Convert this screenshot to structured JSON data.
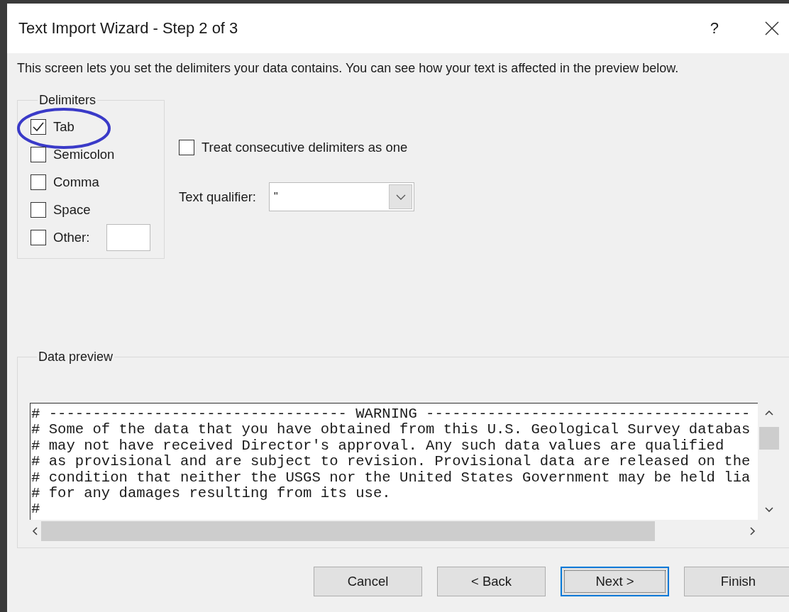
{
  "window": {
    "title": "Text Import Wizard - Step 2 of 3",
    "help": "?"
  },
  "intro": "This screen lets you set the delimiters your data contains.  You can see how your text is affected in the preview below.",
  "delimiters": {
    "legend": "Delimiters",
    "items": [
      {
        "label": "Tab",
        "checked": true,
        "circled": true
      },
      {
        "label": "Semicolon",
        "checked": false,
        "circled": false
      },
      {
        "label": "Comma",
        "checked": false,
        "circled": false
      },
      {
        "label": "Space",
        "checked": false,
        "circled": false
      }
    ],
    "other": {
      "label": "Other:",
      "checked": false
    }
  },
  "treat_consecutive": {
    "label": "Treat consecutive delimiters as one",
    "checked": false
  },
  "text_qualifier": {
    "label": "Text qualifier:",
    "value": "\""
  },
  "data_preview": {
    "legend": "Data preview",
    "lines": [
      "# ---------------------------------- WARNING -------------------------------------",
      "# Some of the data that you have obtained from this U.S. Geological Survey databas",
      "# may not have received Director's approval. Any such data values are qualified",
      "# as provisional and are subject to revision. Provisional data are released on the",
      "# condition that neither the USGS nor the United States Government may be held lia",
      "# for any damages resulting from its use.",
      "#"
    ]
  },
  "buttons": [
    {
      "label": "Cancel",
      "default": false
    },
    {
      "label": "< Back",
      "default": false
    },
    {
      "label": "Next >",
      "default": true
    },
    {
      "label": "Finish",
      "default": false
    }
  ]
}
